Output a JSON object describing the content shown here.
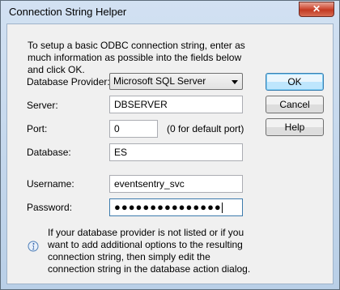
{
  "window": {
    "title": "Connection String Helper",
    "close_glyph": "✕"
  },
  "intro": "To setup a basic ODBC connection string, enter as much information as possible into the fields below and click OK.",
  "fields": {
    "provider_label": "Database Provider:",
    "provider_value": "Microsoft SQL Server",
    "server_label": "Server:",
    "server_value": "DBSERVER",
    "port_label": "Port:",
    "port_value": "0",
    "port_hint": "(0 for default port)",
    "database_label": "Database:",
    "database_value": "ES",
    "username_label": "Username:",
    "username_value": "eventsentry_svc",
    "password_label": "Password:",
    "password_mask": "●●●●●●●●●●●●●●●"
  },
  "buttons": {
    "ok": "OK",
    "cancel": "Cancel",
    "help": "Help"
  },
  "info": {
    "icon": "info-icon",
    "text": "If your database provider is not listed or if you want to add additional options to the resulting connection string, then simply edit the connection string in the database action dialog."
  }
}
